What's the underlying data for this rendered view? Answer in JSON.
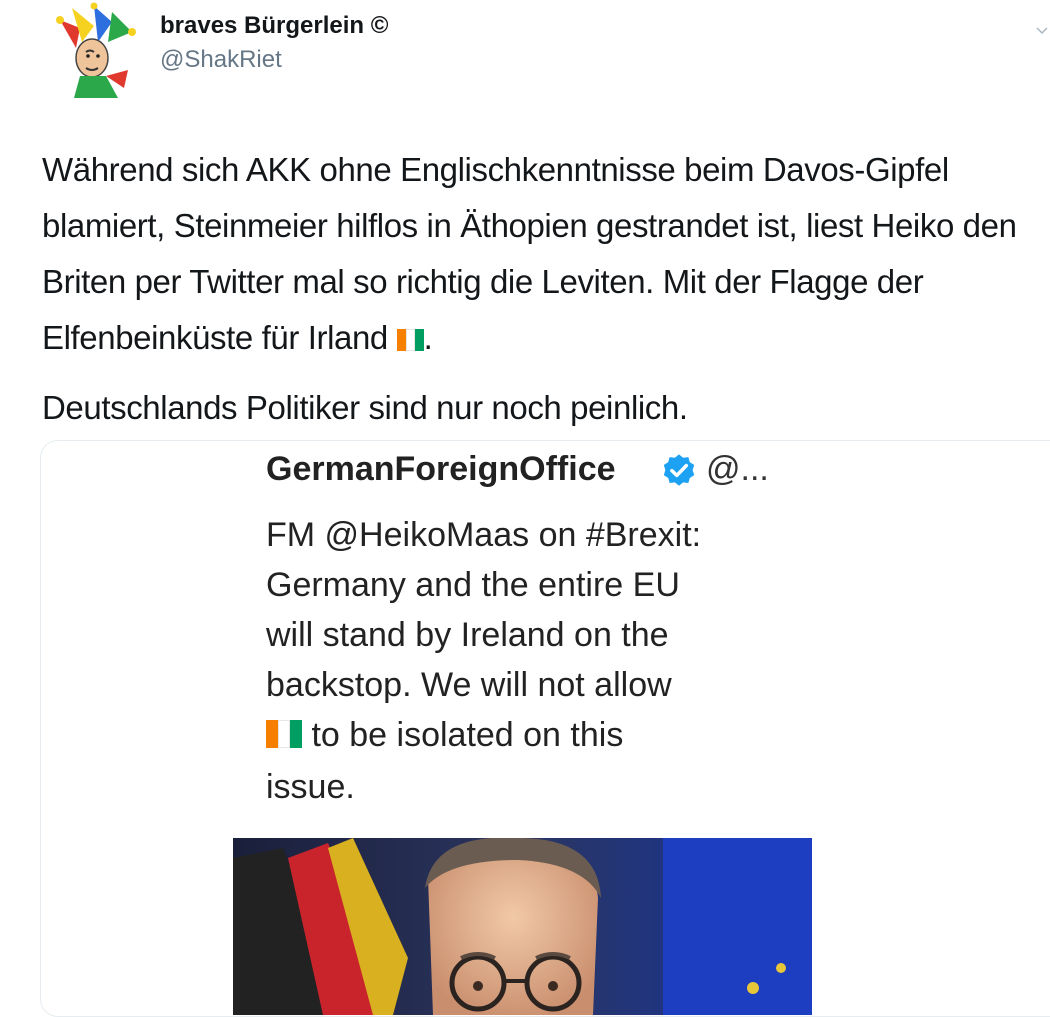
{
  "tweet": {
    "author": {
      "display_name": "braves Bürgerlein ©",
      "handle": "@ShakRiet",
      "avatar_icon": "jester-avatar-icon"
    },
    "menu_icon": "chevron-down-icon",
    "paragraph1_before_flag": "Während sich AKK ohne Englischkenntnisse beim Davos-Gipfel blamiert, Steinmeier hilflos in Äthopien gestrandet ist, liest Heiko den Briten per Twitter mal so richtig die Leviten. Mit der Flagge der Elfenbeinküste für Irland ",
    "paragraph1_after_flag": ".",
    "paragraph2": "Deutschlands Politiker sind nur noch peinlich.",
    "flag_icon": "ivory-coast-flag-icon"
  },
  "quoted": {
    "name": "GermanForeignOffice",
    "verified_icon": "verified-badge-icon",
    "handle": "@...",
    "line1": "FM @HeikoMaas on #Brexit:",
    "line2": "Germany and the entire EU",
    "line3": "will stand by Ireland on the",
    "line4": "backstop. We will not allow",
    "line5": " to  be isolated on this",
    "line6": "issue.",
    "photo_icon": "politician-photo-icon"
  },
  "colors": {
    "text": "#14171a",
    "secondary": "#657786",
    "verified": "#1da1f2",
    "flag_orange": "#f77f00",
    "flag_white": "#ffffff",
    "flag_green": "#009e60"
  }
}
